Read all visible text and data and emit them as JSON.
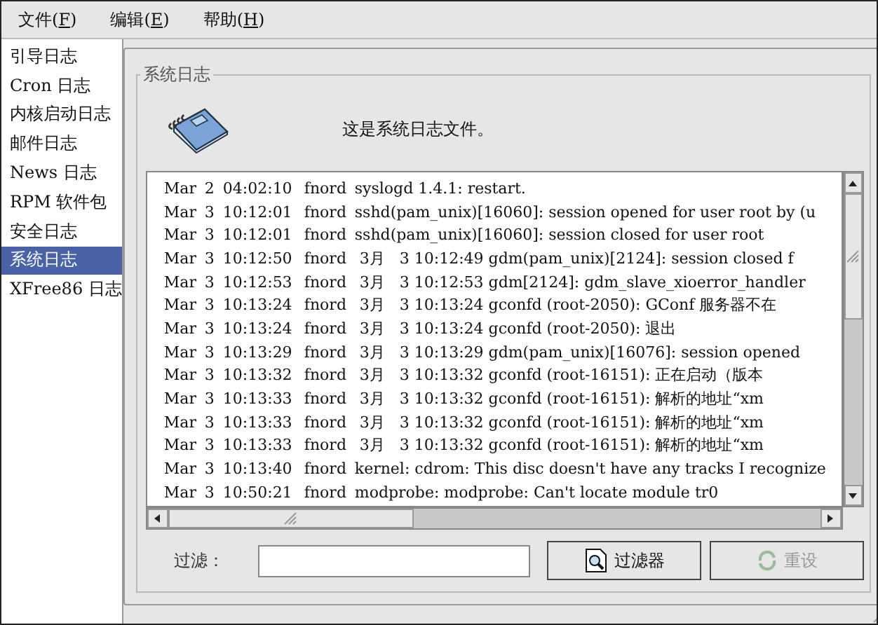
{
  "menu": [
    {
      "label": "文件(",
      "key": "F",
      "after": ")"
    },
    {
      "label": "编辑(",
      "key": "E",
      "after": ")"
    },
    {
      "label": "帮助(",
      "key": "H",
      "after": ")"
    }
  ],
  "sidebar": {
    "items": [
      {
        "label": "引导日志",
        "selected": false
      },
      {
        "label": "Cron  日志",
        "selected": false
      },
      {
        "label": "内核启动日志",
        "selected": false
      },
      {
        "label": "邮件日志",
        "selected": false
      },
      {
        "label": "News  日志",
        "selected": false
      },
      {
        "label": "RPM  软件包",
        "selected": false
      },
      {
        "label": "安全日志",
        "selected": false
      },
      {
        "label": "系统日志",
        "selected": true
      },
      {
        "label": "XFree86  日志",
        "selected": false
      }
    ]
  },
  "panel": {
    "title": "系统日志",
    "description": "这是系统日志文件。"
  },
  "log": {
    "rows": [
      {
        "month": "Mar",
        "day": "2",
        "time": "04:02:10",
        "host": "fnord",
        "message": "syslogd 1.4.1: restart."
      },
      {
        "month": "Mar",
        "day": "3",
        "time": "10:12:01",
        "host": "fnord",
        "message": "sshd(pam_unix)[16060]: session opened for user root by (u"
      },
      {
        "month": "Mar",
        "day": "3",
        "time": "10:12:01",
        "host": "fnord",
        "message": "sshd(pam_unix)[16060]: session closed for user root"
      },
      {
        "month": "Mar",
        "day": "3",
        "time": "10:12:50",
        "host": "fnord",
        "message": " 3月   3 10:12:49 gdm(pam_unix)[2124]: session closed f"
      },
      {
        "month": "Mar",
        "day": "3",
        "time": "10:12:53",
        "host": "fnord",
        "message": " 3月   3 10:12:53 gdm[2124]: gdm_slave_xioerror_handler"
      },
      {
        "month": "Mar",
        "day": "3",
        "time": "10:13:24",
        "host": "fnord",
        "message": " 3月   3 10:13:24 gconfd (root-2050): GConf 服务器不在"
      },
      {
        "month": "Mar",
        "day": "3",
        "time": "10:13:24",
        "host": "fnord",
        "message": " 3月   3 10:13:24 gconfd (root-2050): 退出"
      },
      {
        "month": "Mar",
        "day": "3",
        "time": "10:13:29",
        "host": "fnord",
        "message": " 3月   3 10:13:29 gdm(pam_unix)[16076]: session opened"
      },
      {
        "month": "Mar",
        "day": "3",
        "time": "10:13:32",
        "host": "fnord",
        "message": " 3月   3 10:13:32 gconfd (root-16151): 正在启动（版本"
      },
      {
        "month": "Mar",
        "day": "3",
        "time": "10:13:33",
        "host": "fnord",
        "message": " 3月   3 10:13:32 gconfd (root-16151): 解析的地址“xm"
      },
      {
        "month": "Mar",
        "day": "3",
        "time": "10:13:33",
        "host": "fnord",
        "message": " 3月   3 10:13:32 gconfd (root-16151): 解析的地址“xm"
      },
      {
        "month": "Mar",
        "day": "3",
        "time": "10:13:33",
        "host": "fnord",
        "message": " 3月   3 10:13:32 gconfd (root-16151): 解析的地址“xm"
      },
      {
        "month": "Mar",
        "day": "3",
        "time": "10:13:40",
        "host": "fnord",
        "message": "kernel: cdrom: This disc doesn't have any tracks I recognize"
      },
      {
        "month": "Mar",
        "day": "3",
        "time": "10:50:21",
        "host": "fnord",
        "message": "modprobe: modprobe: Can't locate module tr0"
      }
    ]
  },
  "filter": {
    "label": "过滤："
  },
  "buttons": [
    {
      "label": "过滤器",
      "kind": "filter",
      "disabled": false
    },
    {
      "label": "重设",
      "kind": "reset",
      "disabled": true
    }
  ]
}
